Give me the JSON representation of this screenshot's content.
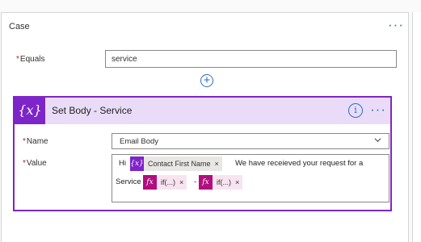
{
  "case": {
    "title": "Case",
    "more_label": "···",
    "equals_label": "Equals",
    "required_mark": "*",
    "equals_value": "service",
    "add_label": "+"
  },
  "action": {
    "icon_text": "{x}",
    "title": "Set Body - Service",
    "info_label": "i",
    "more_label": "···",
    "name_label": "Name",
    "name_value": "Email Body",
    "value_label": "Value",
    "value": {
      "text_hi": "Hi",
      "token_contact": {
        "icon": "{x}",
        "label": "Contact First Name",
        "remove": "×"
      },
      "text_request": "We have receieved your request for a",
      "text_service": "Service",
      "token_fx1": {
        "icon": "fx",
        "label": "if(...)",
        "remove": "×"
      },
      "separator": "-",
      "token_fx2": {
        "icon": "fx",
        "label": "if(...)",
        "remove": "×"
      }
    }
  },
  "colors": {
    "accent": "#2d6ec2",
    "variable_purple": "#7e25c9",
    "header_lavender": "#eadcf8",
    "expression_magenta": "#b10e7f",
    "required_red": "#a4262c"
  }
}
